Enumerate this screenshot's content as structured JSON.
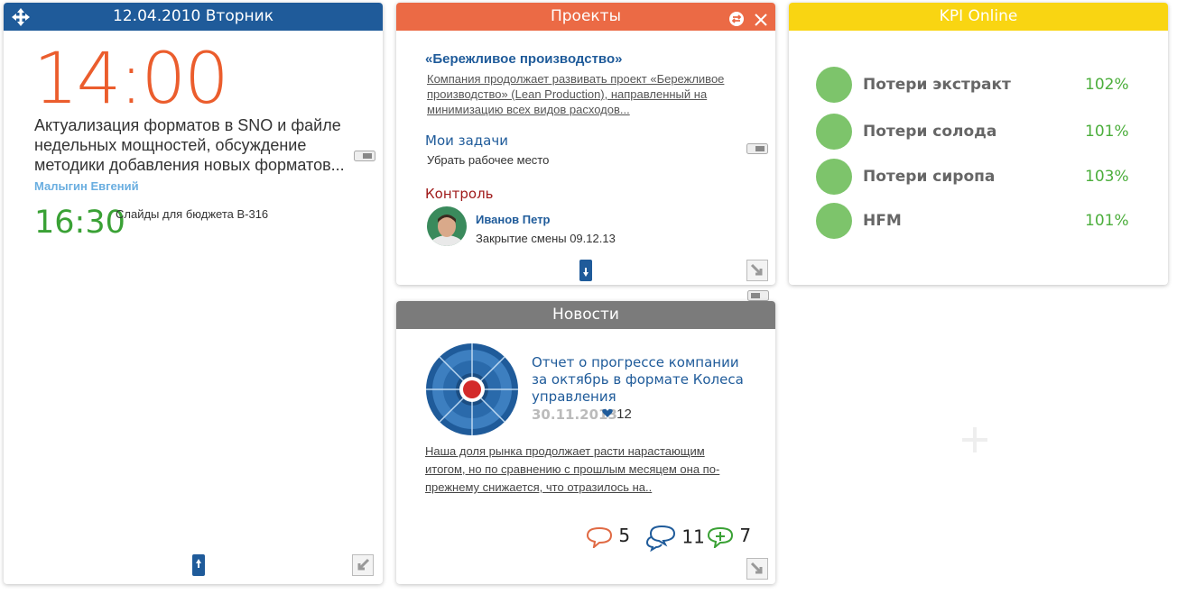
{
  "calendar": {
    "date_header": "12.04.2010 Вторник",
    "main_time": "14:00",
    "main_event": "Актуализация форматов в SNO и файле недельных мощностей, обсуждение методики добавления новых форматов...",
    "main_person": "Малыгин Евгений",
    "second_time": "16:30",
    "second_event": "Слайды для бюджета В-316",
    "colors": {
      "header": "#1f5b9a",
      "main_time": "#eb5d2d",
      "second_time": "#3aa135"
    }
  },
  "projects": {
    "header": "Проекты",
    "project_title": "«Бережливое производство»",
    "project_desc": "Компания продолжает развивать проект «Бережливое производство» (Lean Production), направленный на минимизацию всех видов расходов...",
    "tasks_label": "Мои задачи",
    "task_text": "Убрать рабочее место",
    "control_label": "Контроль",
    "control_person": "Иванов Петр",
    "control_text": "Закрытие смены 09.12.13",
    "colors": {
      "header": "#eb6a45"
    }
  },
  "kpi": {
    "header": "KPI Online",
    "items": [
      {
        "name": "Потери экстракт",
        "value": "102%",
        "status_color": "#7dc46b"
      },
      {
        "name": "Потери солода",
        "value": "101%",
        "status_color": "#7dc46b"
      },
      {
        "name": "Потери сиропа",
        "value": "103%",
        "status_color": "#7dc46b"
      },
      {
        "name": "HFM",
        "value": "101%",
        "status_color": "#7dc46b"
      }
    ],
    "colors": {
      "header": "#f9d512"
    }
  },
  "news": {
    "header": "Новости",
    "title": "Отчет о прогрессе компании за октябрь в формате Колеса управления",
    "date": "30.11.2013",
    "likes": "12",
    "body": "Наша доля рынка продолжает расти нарастающим итогом, но по сравнению с прошлым месяцем она по-прежнему снижается, что отразилось на..",
    "counts": {
      "comments": "5",
      "discussions": "11",
      "followers": "7"
    },
    "colors": {
      "header": "#7b7b7b"
    }
  },
  "icons": [
    "move-icon",
    "settings-icon",
    "close-icon",
    "expand-icon",
    "collapse-icon",
    "toggle-icon",
    "add-widget-icon",
    "heart-icon",
    "comment-icon",
    "discussion-icon",
    "follow-icon"
  ]
}
